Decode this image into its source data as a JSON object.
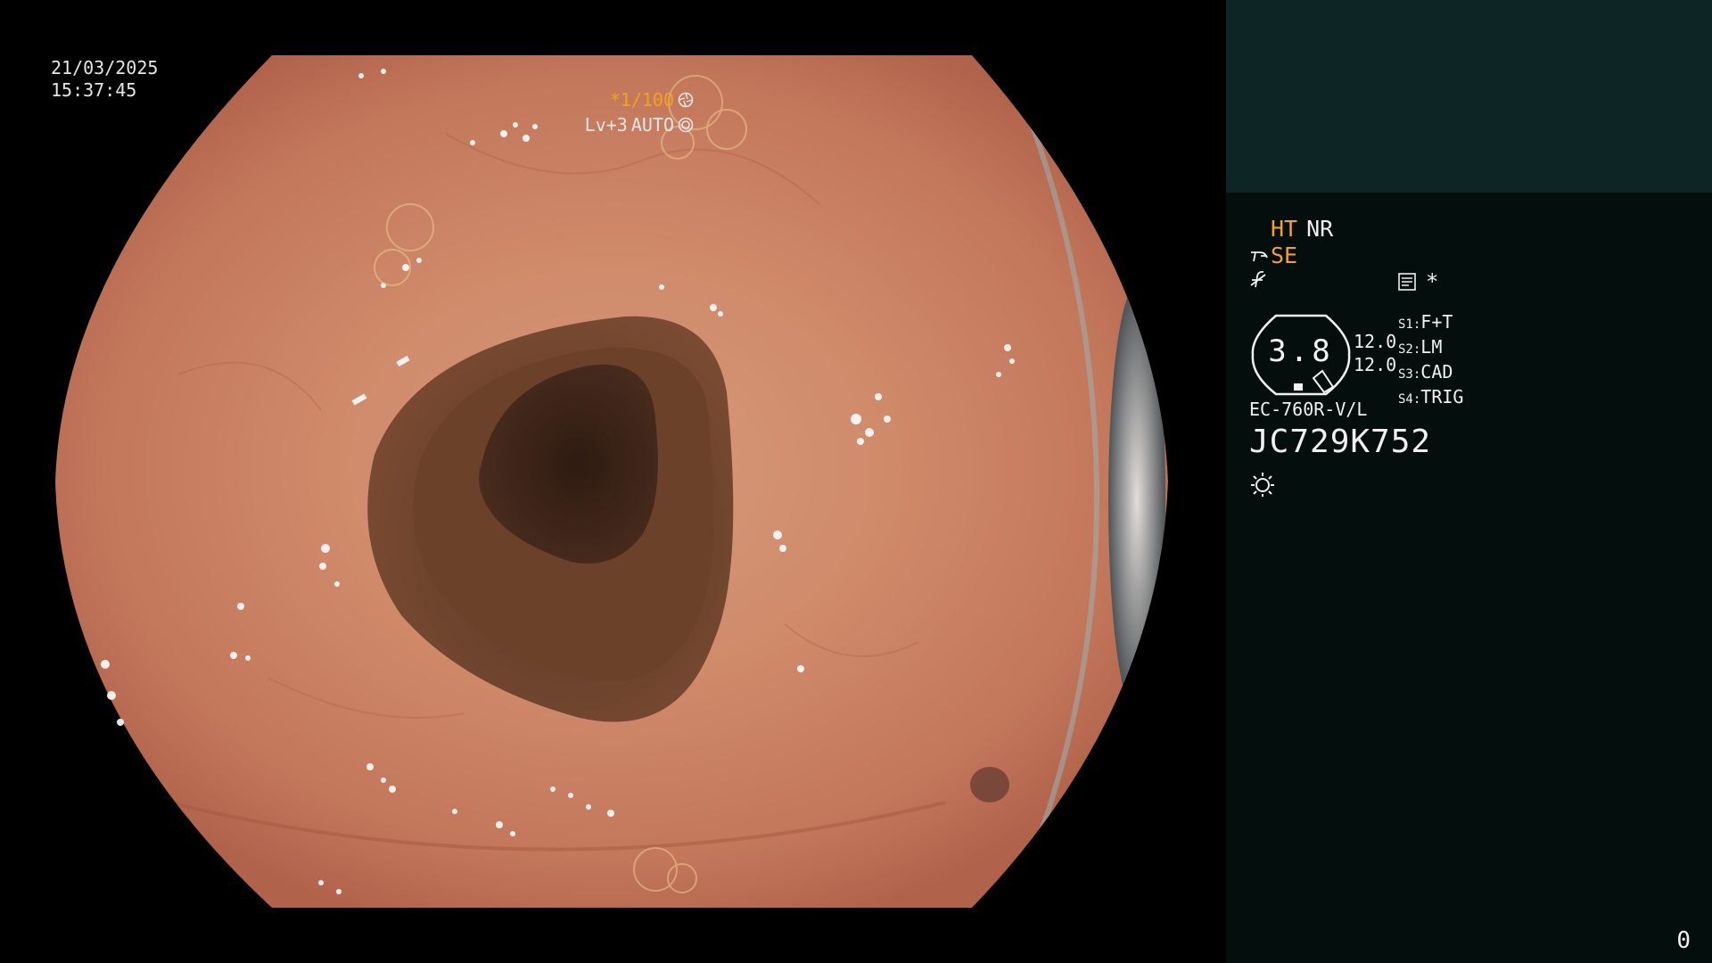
{
  "overlay": {
    "date": "21/03/2025",
    "time": "15:37:45",
    "shutter": "*1/100",
    "shutter_icon": "shutter-icon",
    "iris_level": "Lv+3",
    "iris_mode": "AUTO",
    "iris_icon": "iris-icon"
  },
  "panel": {
    "mode_ht": "HT",
    "mode_nr": "NR",
    "se_icon": "lamp-icon",
    "se_label": "SE",
    "f_symbol": "f",
    "system_icon": "document-icon",
    "system_star": "*",
    "gauge_value": "3.8",
    "gauge_icon": "bend-gauge-icon",
    "gauge_top": "12.0",
    "gauge_bottom": "12.0",
    "slots": [
      {
        "key": "S1:",
        "value": "F+T"
      },
      {
        "key": "S2:",
        "value": "LM"
      },
      {
        "key": "S3:",
        "value": "CAD"
      },
      {
        "key": "S4:",
        "value": "TRIG"
      }
    ],
    "scope_model": "EC-760R-V/L",
    "scope_serial": "JC729K752",
    "light_icon": "light-sun-icon",
    "counter": "0"
  },
  "colors": {
    "background": "#000000",
    "panel_dark": "#040f0d",
    "panel_top": "#0d2524",
    "accent_orange": "#f2a221",
    "text": "#f0f0f0"
  }
}
